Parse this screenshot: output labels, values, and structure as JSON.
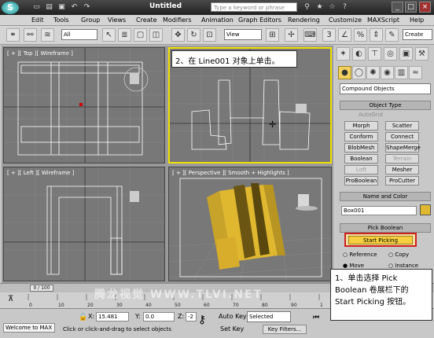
{
  "titlebar": {
    "logo": "S",
    "title": "Untitled",
    "search_placeholder": "Type a keyword or phrase",
    "window_buttons": [
      "_",
      "□",
      "×"
    ]
  },
  "menu": [
    "Edit",
    "Tools",
    "Group",
    "Views",
    "Create",
    "Modifiers",
    "Animation",
    "Graph Editors",
    "Rendering",
    "Customize",
    "MAXScript",
    "Help"
  ],
  "toolbar": {
    "filter_value": "All",
    "coord_value": "View",
    "create_selection_value": "Create"
  },
  "viewports": {
    "top": "[ + ][ Top ][ Wireframe ]",
    "front_note": "2、在 Line001 对象上单击。",
    "left": "[ + ][ Left ][ Wireframe ]",
    "perspective": "[ + ][ Perspective ][ Smooth + Highlights ]"
  },
  "panel": {
    "category": "Compound Objects",
    "object_type_head": "Object Type",
    "autogrid": "AutoGrid",
    "buttons": [
      [
        "Morph",
        "Scatter"
      ],
      [
        "Conform",
        "Connect"
      ],
      [
        "BlobMesh",
        "ShapeMerge"
      ],
      [
        "Boolean",
        "Terrain"
      ],
      [
        "Loft",
        "Mesher"
      ],
      [
        "ProBoolean",
        "ProCutter"
      ]
    ],
    "name_color_head": "Name and Color",
    "object_name": "Box001",
    "pick_boolean_head": "Pick Boolean",
    "start_picking": "Start Picking",
    "radio_reference": "Reference",
    "radio_copy": "Copy",
    "radio_move": "Move",
    "radio_instance": "Instance",
    "accent_color": "#e0b830"
  },
  "timeline": {
    "frame": "0 / 100"
  },
  "track_ticks": [
    "0",
    "10",
    "20",
    "30",
    "40",
    "50",
    "60",
    "70",
    "80",
    "90",
    "100"
  ],
  "status": {
    "maxscript": "Welcome to MAX",
    "x_label": "X:",
    "x_value": "15.481",
    "y_label": "Y:",
    "y_value": "0.0",
    "z_label": "Z:",
    "z_value": "-2",
    "message": "Click or click-and-drag to select objects",
    "auto_key": "Auto Key",
    "selected": "Selected",
    "set_key": "Set Key",
    "key_filters": "Key Filters..."
  },
  "callout_bottom": "1、单击选择 Pick Boolean 卷展栏下的 Start Picking 按钮。",
  "watermark": "腾龙视觉 WWW.TLVI.NET"
}
